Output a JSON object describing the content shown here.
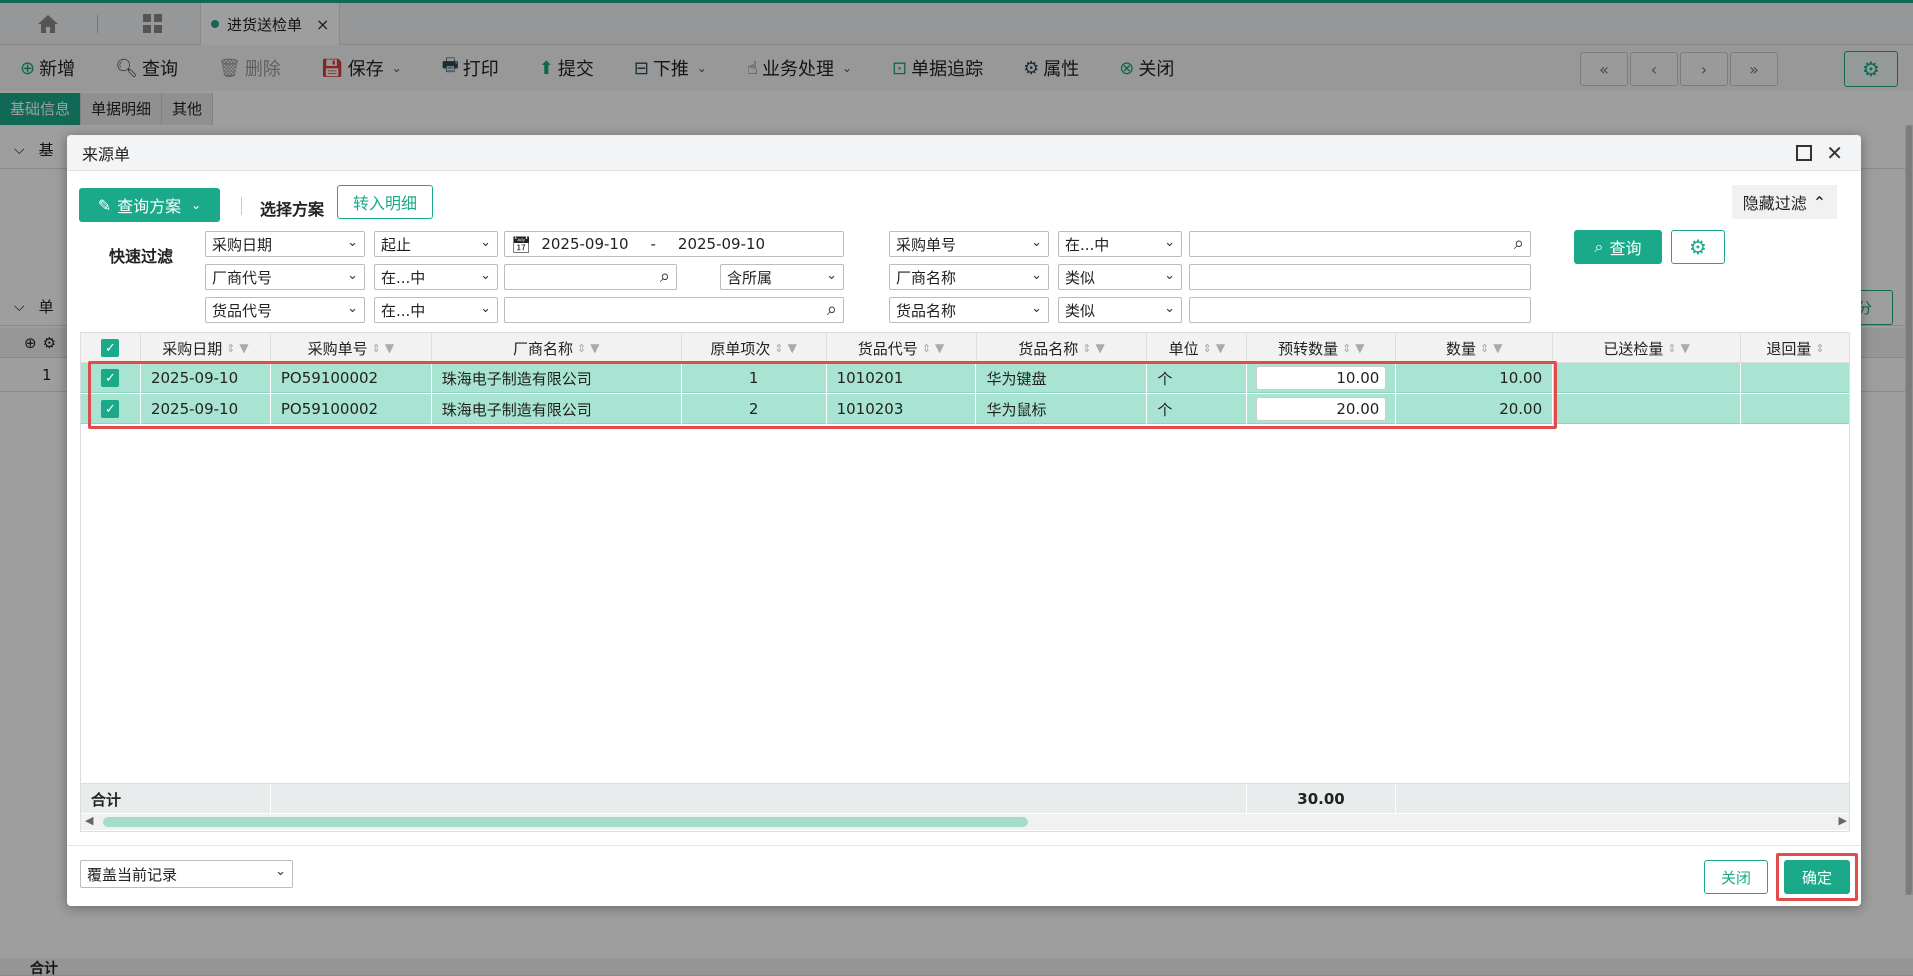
{
  "topbar": {
    "tab_title": "进货送检单",
    "tab_close": "×"
  },
  "toolbar": {
    "items": [
      {
        "label": "新增",
        "icon": "plus-circle-icon"
      },
      {
        "label": "查询",
        "icon": "search-icon"
      },
      {
        "label": "删除",
        "icon": "trash-icon"
      },
      {
        "label": "保存",
        "icon": "save-icon"
      },
      {
        "label": "打印",
        "icon": "printer-icon"
      },
      {
        "label": "提交",
        "icon": "submit-icon"
      },
      {
        "label": "下推",
        "icon": "push-down-icon"
      },
      {
        "label": "业务处理",
        "icon": "hand-pointer-icon"
      },
      {
        "label": "单据追踪",
        "icon": "track-icon"
      },
      {
        "label": "属性",
        "icon": "gear-icon"
      },
      {
        "label": "关闭",
        "icon": "close-circle-icon"
      }
    ]
  },
  "subtabs": [
    "基础信息",
    "单据明细",
    "其他"
  ],
  "background": {
    "section1_label": "基",
    "section2_label": "单",
    "row_number": "1",
    "total_label": "合计",
    "right_btn": "分"
  },
  "modal": {
    "title": "来源单",
    "query_scheme_btn": "查询方案",
    "select_scheme_label": "选择方案",
    "transfer_detail_btn": "转入明细",
    "hide_filter_btn": "隐藏过滤",
    "quick_filter_label": "快速过滤",
    "query_btn": "查询",
    "filters": {
      "f1_field": "采购日期",
      "f1_op": "起止",
      "f1_date_from": "2025-09-10",
      "f1_date_sep": "-",
      "f1_date_to": "2025-09-10",
      "f2_field": "厂商代号",
      "f2_op": "在...中",
      "f2_value": "",
      "f2_scope": "含所属",
      "f3_field": "货品代号",
      "f3_op": "在...中",
      "f3_value": "",
      "f4_field": "采购单号",
      "f4_op": "在...中",
      "f4_value": "",
      "f5_field": "厂商名称",
      "f5_op": "类似",
      "f5_value": "",
      "f6_field": "货品名称",
      "f6_op": "类似",
      "f6_value": ""
    },
    "grid": {
      "headers": [
        "采购日期",
        "采购单号",
        "厂商名称",
        "原单项次",
        "货品代号",
        "货品名称",
        "单位",
        "预转数量",
        "数量",
        "已送检量",
        "退回量"
      ],
      "rows": [
        {
          "date": "2025-09-10",
          "po": "PO59100002",
          "vendor": "珠海电子制造有限公司",
          "line": "1",
          "code": "1010201",
          "name": "华为键盘",
          "unit": "个",
          "pre_qty": "10.00",
          "qty": "10.00"
        },
        {
          "date": "2025-09-10",
          "po": "PO59100002",
          "vendor": "珠海电子制造有限公司",
          "line": "2",
          "code": "1010203",
          "name": "华为鼠标",
          "unit": "个",
          "pre_qty": "20.00",
          "qty": "20.00"
        }
      ],
      "total_label": "合计",
      "total_pre_qty": "30.00"
    },
    "footer": {
      "mode_select": "覆盖当前记录",
      "close_btn": "关闭",
      "confirm_btn": "确定"
    }
  },
  "colors": {
    "accent": "#1aaa8a",
    "row_selected": "#a9e4d3",
    "highlight_red": "#e24b4b"
  }
}
